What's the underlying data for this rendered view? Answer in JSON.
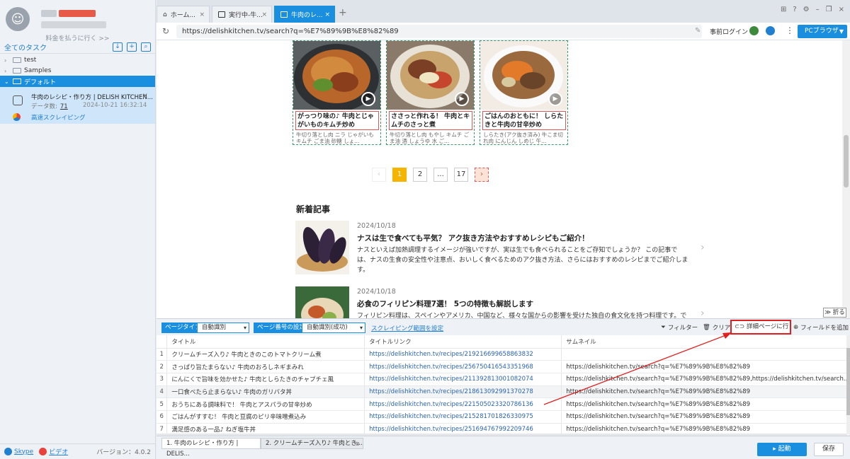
{
  "sidebar": {
    "upgrade_link": "料金を払うに行く >>",
    "task_header": "全てのタスク",
    "tree": [
      {
        "label": "test"
      },
      {
        "label": "Samples"
      },
      {
        "label": "デフォルト"
      }
    ],
    "task": {
      "name": "牛肉のレシピ・作り方 | DELISH KITCHEN...",
      "count_label": "データ数:",
      "count": "71",
      "date": "2024-10-21 16:32:14",
      "mode": "高速スクレイピング"
    },
    "footer": {
      "skype": "Skype",
      "video": "ビデオ",
      "version": "バージョン：4.0.2"
    }
  },
  "tabs": [
    {
      "label": "ホーム..."
    },
    {
      "label": "実行中-牛..."
    },
    {
      "label": "牛肉のレ..."
    }
  ],
  "address": {
    "url": "https://delishkitchen.tv/search?q=%E7%89%9B%E8%82%89",
    "pre_login": "事前ログイン",
    "browser_mode": "PCブラウザ"
  },
  "recipes": [
    {
      "title": "がっつり味の♪ 牛肉とじゃがいものキムチ炒め",
      "desc": "牛切り落とし肉 ニラ じゃがいも キムチ ごま油 砂糖 しょ..."
    },
    {
      "title": "ささっと作れる！ 牛肉とキムチのさっと煮",
      "desc": "牛切り落とし肉 もやし キムチ ごま油 酒 しょうゆ 水 ご..."
    },
    {
      "title": "ごはんのおともに！ しらたきと牛肉の甘辛炒め",
      "desc": "しらたき(アク抜き済み) 牛こま切れ肉 にんじん しめじ 午..."
    }
  ],
  "pager": {
    "prev": "‹",
    "pages": [
      "1",
      "2",
      "...",
      "17"
    ],
    "next": "›"
  },
  "news": {
    "section_title": "新着記事",
    "items": [
      {
        "date": "2024/10/18",
        "headline": "ナスは生で食べても平気？ アク抜き方法やおすすめレシピもご紹介！",
        "body": "ナスといえば加熱調理するイメージが強いですが、実は生でも食べられることをご存知でしょうか？ この記事では、ナスの生食の安全性や注意点、おいしく食べるためのアク抜き方法、さらにはおすすめのレシピまでご紹介します。"
      },
      {
        "date": "2024/10/18",
        "headline": "必食のフィリピン料理7選！ 5つの特徴も解説します",
        "body": "フィリピン料理は、スペインやアメリカ、中国など、様々な国からの影響を受けた独自の食文化を持つ料理です。では一..."
      }
    ]
  },
  "fold_label": "折る",
  "toolbar": {
    "page_type_label": "ページタイプ",
    "page_type_value": "自動識別",
    "page_number_label": "ページ番号の設定",
    "page_number_value": "自動識別(成功)",
    "scrape_range": "スクレイピング範囲を設定",
    "filter": "フィルター",
    "clear": "クリア",
    "detail": "詳細ページに行く",
    "add_field": "フィールドを追加"
  },
  "table": {
    "columns": [
      "",
      "タイトル",
      "タイトルリンク",
      "サムネイル"
    ],
    "rows": [
      {
        "n": "1",
        "title": "クリームチーズ入り♪ 牛肉ときのこのトマトクリーム煮",
        "link": "https://delishkitchen.tv/recipes/219216699658863832",
        "thumb": ""
      },
      {
        "n": "2",
        "title": "さっぱり旨たまらない♪ 牛肉のおろしネギまみれ",
        "link": "https://delishkitchen.tv/recipes/256750416543351968",
        "thumb": "https://delishkitchen.tv/search?q=%E7%89%9B%E8%82%89"
      },
      {
        "n": "3",
        "title": "にんにくで旨味を効かせた♪ 牛肉としらたきのチャプチェ風",
        "link": "https://delishkitchen.tv/recipes/211392813001082074",
        "thumb": "https://delishkitchen.tv/search?q=%E7%89%9B%E8%82%89,https://delishkitchen.tv/search..."
      },
      {
        "n": "4",
        "title": "一口食べたら止まらない♪ 牛肉のガリバタ丼",
        "link": "https://delishkitchen.tv/recipes/218613092991370278",
        "thumb": "https://delishkitchen.tv/search?q=%E7%89%9B%E8%82%89"
      },
      {
        "n": "5",
        "title": "おうちにある調味料で！ 牛肉とアスパラの甘辛炒め",
        "link": "https://delishkitchen.tv/recipes/221505023320786136",
        "thumb": "https://delishkitchen.tv/search?q=%E7%89%9B%E8%82%89"
      },
      {
        "n": "6",
        "title": "ごはんがすすむ！ 牛肉と豆腐のピリ辛味噌煮込み",
        "link": "https://delishkitchen.tv/recipes/215281701826330975",
        "thumb": "https://delishkitchen.tv/search?q=%E7%89%9B%E8%82%89"
      },
      {
        "n": "7",
        "title": "満足感のある一品♪ ねぎ塩牛丼",
        "link": "https://delishkitchen.tv/recipes/251694767992209746",
        "thumb": "https://delishkitchen.tv/search?q=%E7%89%9B%E8%82%89"
      }
    ]
  },
  "bottom": {
    "tabs": [
      "1. 牛肉のレシピ・作り方 | DELIS...",
      "2. クリームチーズ入り♪ 牛肉とき..."
    ],
    "start": "▸ 起動",
    "save": "保存"
  },
  "colors": {
    "accent": "#1a8fe0",
    "highlight": "#e02020",
    "current_page": "#f5b400"
  }
}
